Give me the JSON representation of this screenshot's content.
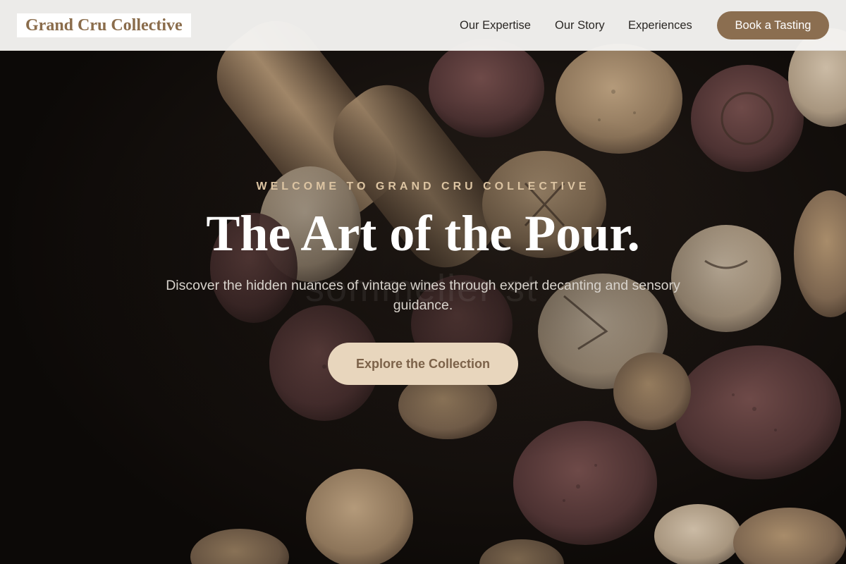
{
  "brand": {
    "logo_text": "Grand Cru Collective"
  },
  "nav": {
    "links": [
      {
        "label": "Our Expertise"
      },
      {
        "label": "Our Story"
      },
      {
        "label": "Experiences"
      }
    ],
    "cta_label": "Book a Tasting"
  },
  "hero": {
    "eyebrow": "WELCOME TO GRAND CRU COLLECTIVE",
    "headline": "The Art of the Pour.",
    "subtitle": "Discover the hidden nuances of vintage wines through expert decanting and sensory guidance.",
    "ghost_text": "sommelier st",
    "cta_label": "Explore the Collection",
    "background_image": "wine-corks-photo"
  },
  "colors": {
    "header_bg": "#f4f3f1",
    "brand_brown": "#8a6c4b",
    "cta_dark": "#8b6e50",
    "cta_light": "#e8d6bd",
    "eyebrow": "#dcc4a2",
    "hero_bg": "#0d0a08"
  }
}
